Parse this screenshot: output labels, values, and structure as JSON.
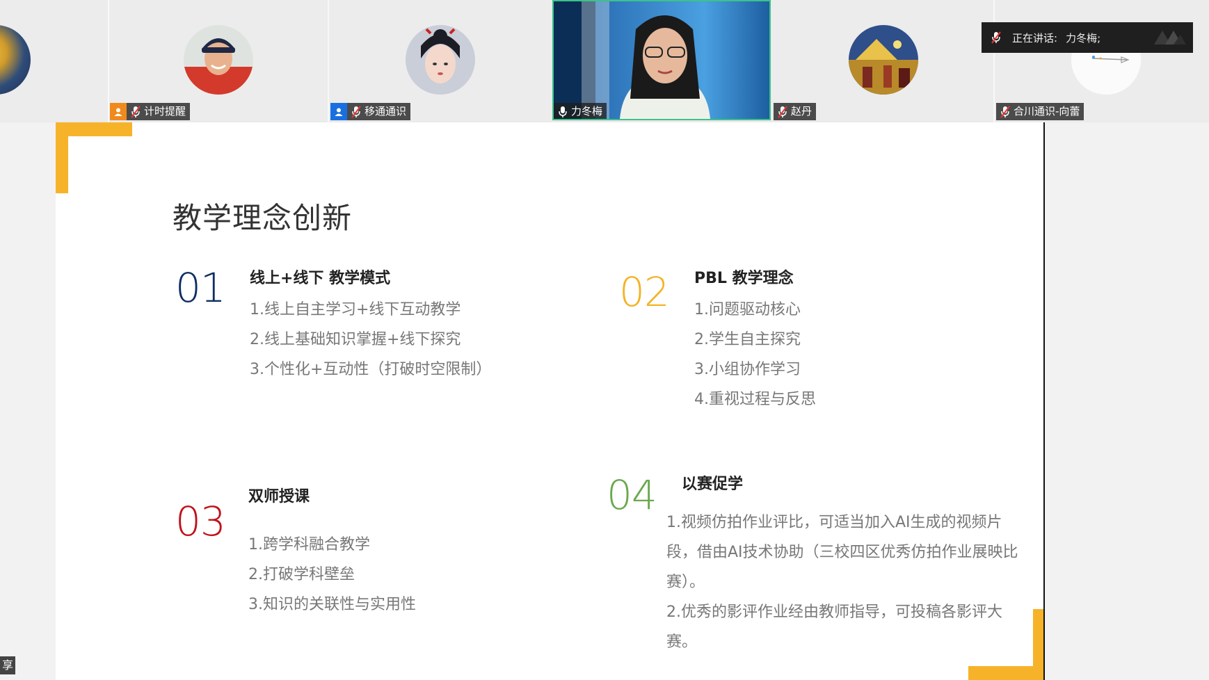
{
  "participants": [
    {
      "id": "p0",
      "name": ""
    },
    {
      "id": "p1",
      "name": "计时提醒",
      "host": true
    },
    {
      "id": "p2",
      "name": "移通通识",
      "host": true
    },
    {
      "id": "p3",
      "name": "力冬梅",
      "active_video": true
    },
    {
      "id": "p4",
      "name": "赵丹"
    },
    {
      "id": "p5",
      "name": "合川通识-向蕾"
    }
  ],
  "speaking_banner": {
    "label": "正在讲话:",
    "speaker": "力冬梅;"
  },
  "slide": {
    "title": "教学理念创新",
    "sections": [
      {
        "number": "01",
        "color": "#0f2e63",
        "heading": "线上+线下 教学模式",
        "items": [
          "1.线上自主学习+线下互动教学",
          "2.线上基础知识掌握+线下探究",
          "3.个性化+互动性（打破时空限制）"
        ]
      },
      {
        "number": "02",
        "color": "#f2b427",
        "heading": "PBL 教学理念",
        "items": [
          "1.问题驱动核心",
          "2.学生自主探究",
          "3.小组协作学习",
          "4.重视过程与反思"
        ]
      },
      {
        "number": "03",
        "color": "#c0121b",
        "heading": "双师授课",
        "items": [
          "1.跨学科融合教学",
          "2.打破学科壁垒",
          "3.知识的关联性与实用性"
        ]
      },
      {
        "number": "04",
        "color": "#6aa84f",
        "heading": "以赛促学",
        "paragraphs": [
          "1.视频仿拍作业评比，可适当加入AI生成的视频片段，借由AI技术协助（三校四区优秀仿拍作业展映比赛）。",
          "2.优秀的影评作业经由教师指导，可投稿各影评大赛。"
        ]
      }
    ]
  },
  "side_tab": {
    "label": "享"
  },
  "colors": {
    "accent_yellow": "#f6b32a",
    "active_border": "#3cc28a",
    "host_badge": "#f08a1c",
    "host_badge_blue": "#1a6fe0"
  }
}
